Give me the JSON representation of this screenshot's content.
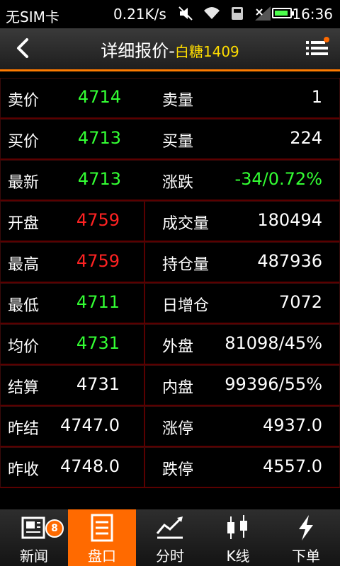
{
  "status": {
    "carrier": "无SIM卡",
    "speed": "0.21K/s",
    "time": "16:36",
    "battery_fill": 0.9
  },
  "header": {
    "title": "详细报价-",
    "code": "白糖1409"
  },
  "rows": [
    {
      "label1": "卖价",
      "value1": "4714",
      "color1": "green",
      "label2": "卖量",
      "value2": "1",
      "color2": "white"
    },
    {
      "label1": "买价",
      "value1": "4713",
      "color1": "green",
      "label2": "买量",
      "value2": "224",
      "color2": "white"
    },
    {
      "label1": "最新",
      "value1": "4713",
      "color1": "green",
      "label2": "涨跌",
      "value2": "-34/0.72%",
      "color2": "green"
    },
    {
      "label1": "开盘",
      "value1": "4759",
      "color1": "red",
      "label2": "成交量",
      "value2": "180494",
      "color2": "white"
    },
    {
      "label1": "最高",
      "value1": "4759",
      "color1": "red",
      "label2": "持仓量",
      "value2": "487936",
      "color2": "white"
    },
    {
      "label1": "最低",
      "value1": "4711",
      "color1": "green",
      "label2": "日增仓",
      "value2": "7072",
      "color2": "white"
    },
    {
      "label1": "均价",
      "value1": "4731",
      "color1": "green",
      "label2": "外盘",
      "value2": "81098/45%",
      "color2": "white"
    },
    {
      "label1": "结算",
      "value1": "4731",
      "color1": "white",
      "label2": "内盘",
      "value2": "99396/55%",
      "color2": "white"
    },
    {
      "label1": "昨结",
      "value1": "4747.0",
      "color1": "white",
      "label2": "涨停",
      "value2": "4937.0",
      "color2": "white"
    },
    {
      "label1": "昨收",
      "value1": "4748.0",
      "color1": "white",
      "label2": "跌停",
      "value2": "4557.0",
      "color2": "white"
    }
  ],
  "nav": [
    {
      "label": "新闻",
      "icon": "news-icon",
      "badge": "8",
      "active": false
    },
    {
      "label": "盘口",
      "icon": "quote-board-icon",
      "active": true
    },
    {
      "label": "分时",
      "icon": "timeshare-chart-icon",
      "active": false
    },
    {
      "label": "K线",
      "icon": "candlestick-icon",
      "active": false
    },
    {
      "label": "下单",
      "icon": "lightning-icon",
      "active": false
    }
  ],
  "colors": {
    "accent": "#ff6a00",
    "green": "#33ff33",
    "red": "#ff2222",
    "code_yellow": "#ffdd00"
  }
}
